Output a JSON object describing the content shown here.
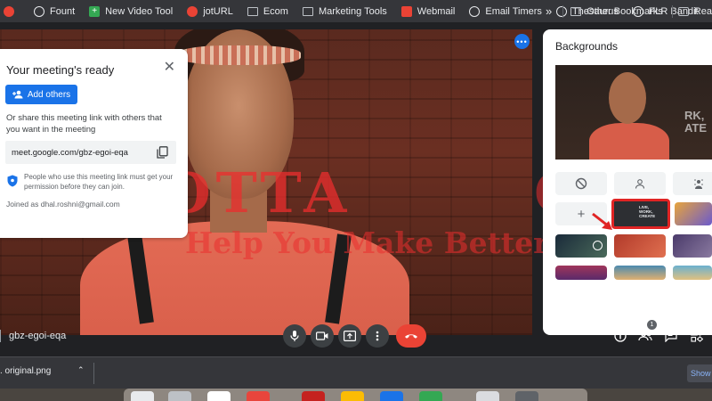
{
  "bookmarks": {
    "items": [
      {
        "label": "",
        "icon": "favicon-icon",
        "color": "#ea4335"
      },
      {
        "label": "Fount",
        "icon": "globe-icon",
        "color": "#e8eaed"
      },
      {
        "label": "New Video Tool",
        "icon": "plus-square-icon",
        "color": "#34a853"
      },
      {
        "label": "jotURL",
        "icon": "jot-icon",
        "color": "#ea4335"
      },
      {
        "label": "Ecom",
        "icon": "folder-icon",
        "color": "#bdc1c6"
      },
      {
        "label": "Marketing Tools",
        "icon": "folder-icon",
        "color": "#bdc1c6"
      },
      {
        "label": "Webmail",
        "icon": "webmail-icon",
        "color": "#ea4335"
      },
      {
        "label": "Email Timers",
        "icon": "globe-icon",
        "color": "#e8eaed"
      },
      {
        "label": "Thesaurus",
        "icon": "globe-icon",
        "color": "#e8eaed"
      },
      {
        "label": "PLR Bandit",
        "icon": "globe-icon",
        "color": "#e8eaed"
      }
    ],
    "overflow": "»",
    "other_bookmarks": "Other Bookmarks",
    "reading_list": "Rea"
  },
  "ready_card": {
    "title": "Your meeting's ready",
    "add_others": "Add others",
    "share_text": "Or share this meeting link with others that you want in the meeting",
    "meeting_link": "meet.google.com/gbz-egoi-eqa",
    "permission_text": "People who use this meeting link must get your permission before they can join.",
    "joined_as": "Joined as dhal.roshni@gmail.com"
  },
  "watermark": {
    "line1": "HOTTA",
    "line2": "Help You Make Better",
    "line3": "OW"
  },
  "backgrounds_panel": {
    "title": "Backgrounds",
    "preview_text": "RK,\nATE",
    "selected_tile_text": "LIVE,\nWORK,\nCREATE"
  },
  "bottom_bar": {
    "meeting_code": "gbz-egoi-eqa",
    "participants_count": "1"
  },
  "download_bar": {
    "file_name": ". original.png",
    "show_all": "Show a"
  },
  "colors": {
    "accent": "#1a73e8",
    "end_call": "#ea4335",
    "highlight": "#e02424"
  }
}
